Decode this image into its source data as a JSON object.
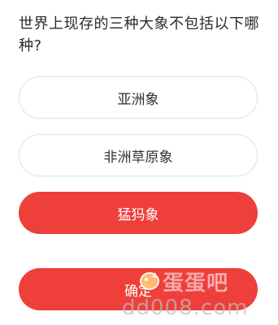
{
  "question": {
    "text": "世界上现存的三种大象不包括以下哪种?"
  },
  "options": [
    {
      "label": "亚洲象",
      "selected": false
    },
    {
      "label": "非洲草原象",
      "selected": false
    },
    {
      "label": "猛犸象",
      "selected": true
    }
  ],
  "confirm_label": "确定",
  "watermark": {
    "title": "蛋蛋吧",
    "url": "dd008.com"
  },
  "colors": {
    "accent": "#ee3f3a",
    "text": "#2b2b2b",
    "border": "#e3e3e3"
  }
}
